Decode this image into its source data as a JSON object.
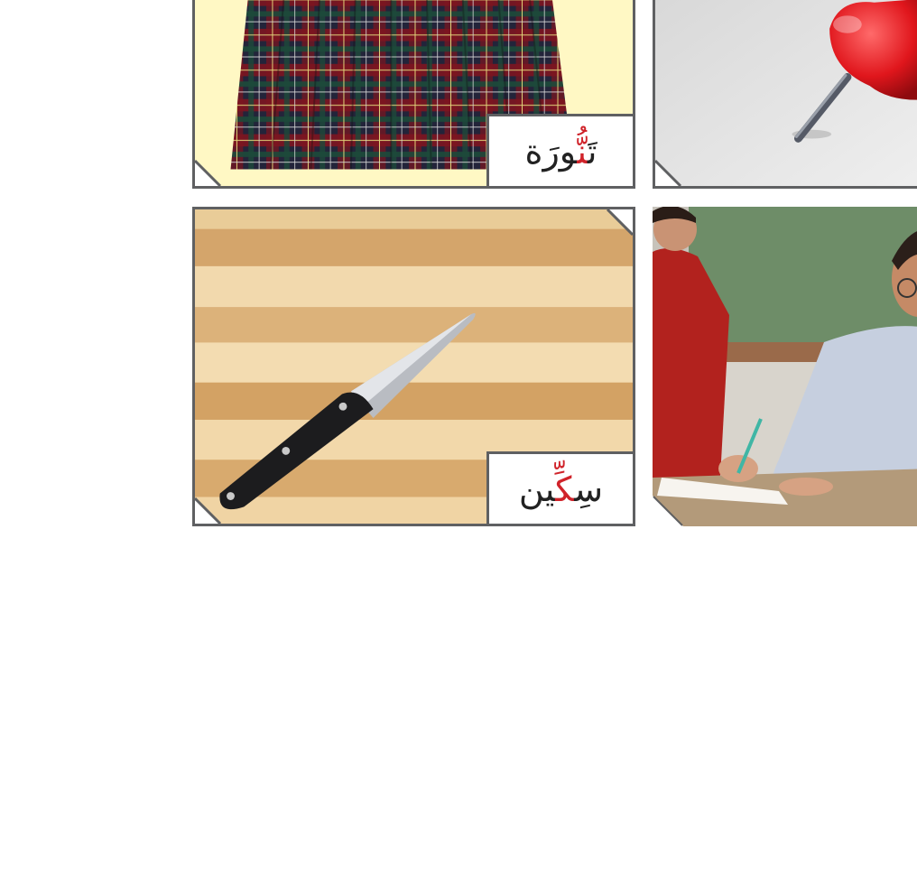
{
  "cards": [
    {
      "id": "skirt",
      "label_before": "تَ",
      "label_highlight": "نّ",
      "label_after": "ُورَة",
      "image": "plaid-skirt-photo"
    },
    {
      "id": "pushpin",
      "image": "red-pushpin-photo"
    },
    {
      "id": "knife",
      "label_before": "سِ",
      "label_highlight": "كّ",
      "label_after": "ِين",
      "image": "knife-on-cutting-board-photo"
    },
    {
      "id": "teacher",
      "image": "teacher-and-student-photo"
    }
  ],
  "colors": {
    "border": "#5f6062",
    "highlight": "#d0232a",
    "skirt_bg": "#fff8c4"
  }
}
